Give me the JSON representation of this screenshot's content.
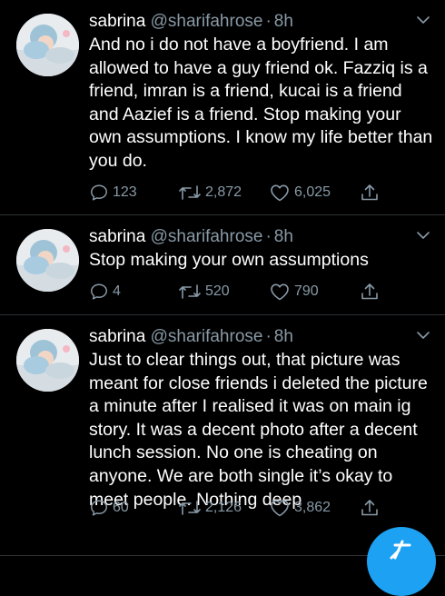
{
  "tweets": [
    {
      "name": "sabrina",
      "handle": "@sharifahrose",
      "separator": "·",
      "time": "8h",
      "text": "And no i do not have a boyfriend. I am allowed to have a guy friend ok. Fazziq is a friend, imran is a friend, kucai is a friend and Aazief is a friend. Stop making your own assumptions. I know my life better than you do.",
      "replies": "123",
      "retweets": "2,872",
      "likes": "6,025"
    },
    {
      "name": "sabrina",
      "handle": "@sharifahrose",
      "separator": "·",
      "time": "8h",
      "text": "Stop making your own assumptions",
      "replies": "4",
      "retweets": "520",
      "likes": "790"
    },
    {
      "name": "sabrina",
      "handle": "@sharifahrose",
      "separator": "·",
      "time": "8h",
      "text": "Just to clear things out, that picture was meant for close friends i deleted the picture a minute after I realised it was on main ig story. It was a decent photo after a decent lunch session. No one is cheating on anyone. We are both single it’s okay to meet people. Nothing deep",
      "replies": "60",
      "retweets": "2,126",
      "likes": "3,862"
    }
  ],
  "icons": {
    "reply": "reply-icon",
    "retweet": "retweet-icon",
    "like": "like-icon",
    "share": "share-icon",
    "more": "chevron-down-icon",
    "compose": "compose-tweet-icon"
  },
  "colors": {
    "background": "#000000",
    "text": "#ffffff",
    "secondary": "#8899a6",
    "divider": "#2f3336",
    "accent": "#1da1f2"
  }
}
